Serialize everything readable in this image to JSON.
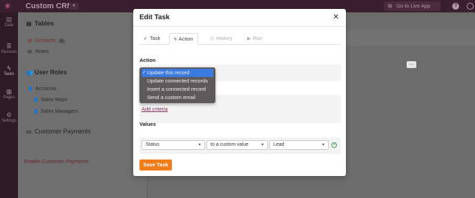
{
  "app": {
    "title": "Custom CRM",
    "live_button": "Go to Live App",
    "nav": [
      {
        "label": "Data",
        "icon": "database-icon"
      },
      {
        "label": "Records",
        "icon": "records-icon"
      },
      {
        "label": "Tasks",
        "icon": "lightning-icon"
      },
      {
        "label": "Pages",
        "icon": "pages-icon"
      },
      {
        "label": "Settings",
        "icon": "gear-icon"
      }
    ]
  },
  "sidebar": {
    "tables_heading": "Tables",
    "tables": [
      {
        "label": "Contacts",
        "count": "5"
      },
      {
        "label": "Notes"
      }
    ],
    "user_roles_heading": "User Roles",
    "user_roles": [
      {
        "label": "Accounts"
      },
      {
        "label": "Sales Reps"
      },
      {
        "label": "Sales Managers"
      }
    ],
    "customer_payments_heading": "Customer Payments",
    "enable_customer_payments": "Enable Customer Payments"
  },
  "modal": {
    "title": "Edit Task",
    "tabs": [
      {
        "label": "Task",
        "icon": "check-icon",
        "state": "normal"
      },
      {
        "label": "Action",
        "icon": "lightning-icon",
        "state": "active"
      },
      {
        "label": "History",
        "icon": "clock-icon",
        "state": "disabled"
      },
      {
        "label": "Run",
        "icon": "play-icon",
        "state": "disabled"
      }
    ],
    "action_label": "Action",
    "action_options": [
      {
        "label": "Update this record",
        "selected": true
      },
      {
        "label": "Update connected records",
        "selected": false
      },
      {
        "label": "Insert a connected record",
        "selected": false
      },
      {
        "label": "Send a custom email",
        "selected": false
      }
    ],
    "more_label": "...",
    "add_criteria": "Add criteria",
    "values_label": "Values",
    "values_row": {
      "field": "Status",
      "operator": "to a custom value",
      "value": "Lead"
    },
    "save_button": "Save Task"
  },
  "colors": {
    "accent": "#f07d1a",
    "selected": "#3b7ae0",
    "link": "#7a2a5a",
    "add": "#3a9a4a"
  }
}
